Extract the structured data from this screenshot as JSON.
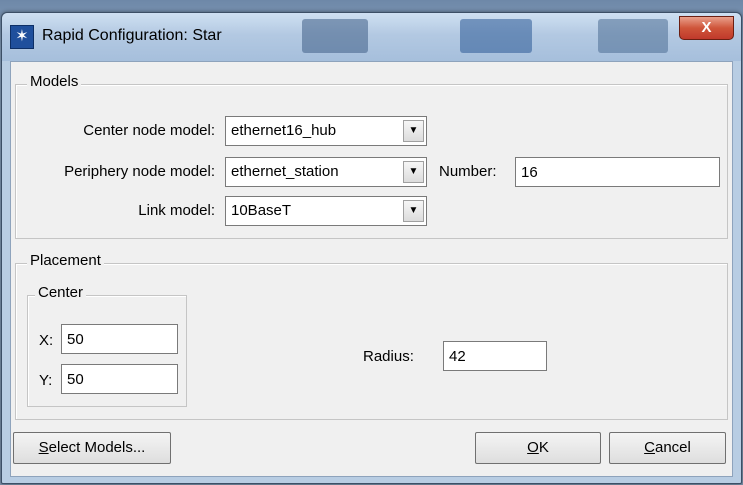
{
  "window": {
    "title": "Rapid Configuration: Star",
    "close_glyph": "X",
    "app_icon": "star-network-icon"
  },
  "models": {
    "legend": "Models",
    "center_label": "Center node model:",
    "center_value": "ethernet16_hub",
    "periphery_label": "Periphery node model:",
    "periphery_value": "ethernet_station",
    "number_label": "Number:",
    "number_value": "16",
    "link_label": "Link model:",
    "link_value": "10BaseT"
  },
  "placement": {
    "legend": "Placement",
    "center_legend": "Center",
    "x_label": "X:",
    "x_value": "50",
    "y_label": "Y:",
    "y_value": "50",
    "radius_label": "Radius:",
    "radius_value": "42"
  },
  "buttons": {
    "select_models_key": "S",
    "select_models_rest": "elect Models...",
    "ok_key": "O",
    "ok_rest": "K",
    "cancel_key": "C",
    "cancel_rest": "ancel"
  },
  "colors": {
    "title_bar": "#b3c9e2",
    "close": "#c0392b",
    "dialog_bg": "#f0f0f0"
  }
}
